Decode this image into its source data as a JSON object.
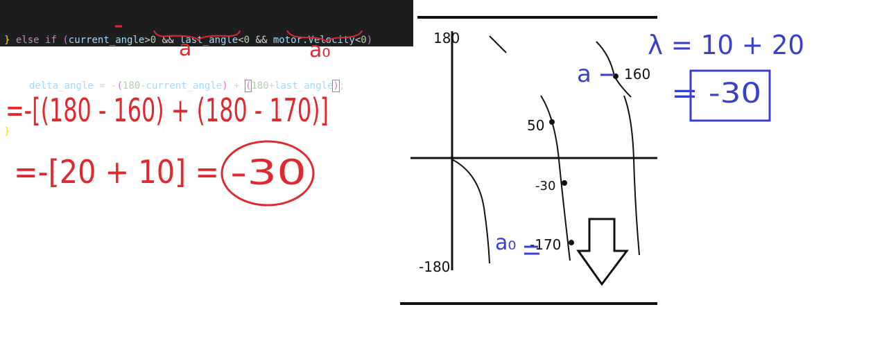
{
  "code": {
    "line1": {
      "close_brace": "}",
      "else_kw": "else",
      "if_kw": "if",
      "open_paren": "(",
      "var_current": "current_angle",
      "gt": ">",
      "zero1": "0",
      "and1": " && ",
      "var_last": "last_angle",
      "lt": "<",
      "zero2": "0",
      "and2": " && ",
      "motor": "motor.Velocity",
      "lt2": "<",
      "zero3": "0",
      "close_paren": ")"
    },
    "line2": {
      "lhs": "delta_angle",
      "assign": " = ",
      "minus": "-",
      "p1_open": "(",
      "n180a": "180",
      "minus2": "-",
      "var_current": "current_angle",
      "p1_close": ")",
      "plus": " + ",
      "p2_open": "(",
      "n180b": "180",
      "plus2": "+",
      "var_last": "last_angle",
      "p2_close": ")",
      "semi": ";"
    },
    "line3": {
      "close_brace": "}"
    }
  },
  "annotations": {
    "under_current": "a",
    "under_last": "a₀"
  },
  "math": {
    "line1": "=-[(180 - 160) + (180 - 170)]",
    "line2": "=-[20 + 10] = ",
    "result": "-30"
  },
  "graph": {
    "y_top": "180",
    "y_bottom": "-180",
    "point_a_label": "a",
    "point_a_value": "160",
    "point_50": "50",
    "point_m30": "-30",
    "point_a0_label": "a₀",
    "point_a0_value": "-170"
  },
  "blue_note": {
    "delta": "λ = 10 + 20",
    "result": "= -30"
  },
  "colors": {
    "red_ink": "#e0282f",
    "blue_ink": "#3a3fd0",
    "black_ink": "#111111"
  }
}
